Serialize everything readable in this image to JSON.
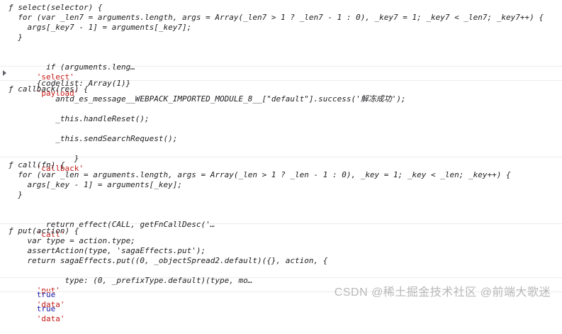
{
  "console": {
    "entries": [
      {
        "lines": [
          "ƒ select(selector) {",
          "  for (var _len7 = arguments.length, args = Array(_len7 > 1 ? _len7 - 1 : 0), _key7 = 1; _key7 < _len7; _key7++) {",
          "    args[_key7 - 1] = arguments[_key7];",
          "  }",
          "",
          "  if (arguments.leng…"
        ],
        "tag": "'select'"
      },
      {
        "lines": [
          "{codelist: Array(1)}"
        ],
        "tag": "'payload'"
      },
      {
        "lines": [
          "ƒ callback(res) {",
          "          antd_es_message__WEBPACK_IMPORTED_MODULE_8__[\"default\"].success('解冻成功');",
          "",
          "          _this.handleReset();",
          "",
          "          _this.sendSearchRequest();",
          "        }"
        ],
        "tag": "'callback'"
      },
      {
        "lines": [
          "ƒ call(fn) {",
          "  for (var _len = arguments.length, args = Array(_len > 1 ? _len - 1 : 0), _key = 1; _key < _len; _key++) {",
          "    args[_key - 1] = arguments[_key];",
          "  }",
          "",
          "  return effect(CALL, getFnCallDesc('…"
        ],
        "tag": "'call'"
      },
      {
        "lines": [
          "ƒ put(action) {",
          "    var type = action.type;",
          "    assertAction(type, 'sagaEffects.put');",
          "    return sagaEffects.put((0, _objectSpread2.default)({}, action, {",
          "      type: (0, _prefixType.default)(type, mo…"
        ],
        "tag": "'put'"
      },
      {
        "lines": [
          "true"
        ],
        "tag": "'data'"
      },
      {
        "lines": [
          "true"
        ],
        "tag": "'data'"
      }
    ]
  },
  "watermark": "CSDN @稀土掘金技术社区 @前端大歌迷",
  "colors": {
    "string": "#c41a16",
    "boolean": "#1a1aa6",
    "text": "#202124",
    "divider": "#ececec"
  }
}
